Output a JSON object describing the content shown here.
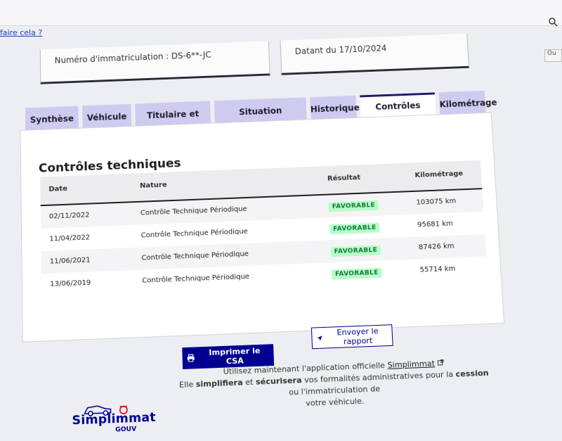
{
  "top": {
    "help_link": "faire cela ?",
    "side_button": "Ou"
  },
  "vehicle_info": {
    "registration_label": "Numéro d'immatriculation : DS-6**-JC",
    "since_label": "Datant du 17/10/2024"
  },
  "tabs": [
    {
      "label": "Synthèse",
      "active": false
    },
    {
      "label": "Véhicule",
      "active": false
    },
    {
      "label": "Titulaire et Titre",
      "active": false
    },
    {
      "label": "Situation administrative",
      "active": false
    },
    {
      "label": "Historique",
      "active": false
    },
    {
      "label": "Contrôles techniques",
      "active": true
    },
    {
      "label": "Kilométrage",
      "active": false
    }
  ],
  "section": {
    "title": "Contrôles techniques",
    "columns": {
      "date": "Date",
      "nature": "Nature",
      "result": "Résultat",
      "mileage": "Kilométrage"
    },
    "rows": [
      {
        "date": "02/11/2022",
        "nature": "Contrôle Technique Périodique",
        "result": "FAVORABLE",
        "mileage": "103075 km"
      },
      {
        "date": "11/04/2022",
        "nature": "Contrôle Technique Périodique",
        "result": "FAVORABLE",
        "mileage": "95681 km"
      },
      {
        "date": "11/06/2021",
        "nature": "Contrôle Technique Périodique",
        "result": "FAVORABLE",
        "mileage": "87426 km"
      },
      {
        "date": "13/06/2019",
        "nature": "Contrôle Technique Périodique",
        "result": "FAVORABLE",
        "mileage": "55714 km"
      }
    ]
  },
  "actions": {
    "print_label": "Imprimer le CSA",
    "report_label": "Envoyer le rapport"
  },
  "footer": {
    "line1_prefix": "Utilisez maintenant l'application officielle",
    "app_link": "Simplimmat",
    "line2_a": "Elle",
    "line2_b": "simplifiera",
    "line2_c": "et",
    "line2_d": "sécurisera",
    "line2_e": "vos formalités administratives pour la",
    "line2_f": "cession",
    "line2_g": "ou l'immatriculation de",
    "line3": "votre véhicule."
  },
  "logo": {
    "brand": "Simplimmat",
    "sub": "GOUV"
  },
  "colors": {
    "primary": "#000091",
    "tab_bg": "#cfcaf0",
    "badge_bg": "#b8fec9",
    "badge_fg": "#18753c"
  }
}
